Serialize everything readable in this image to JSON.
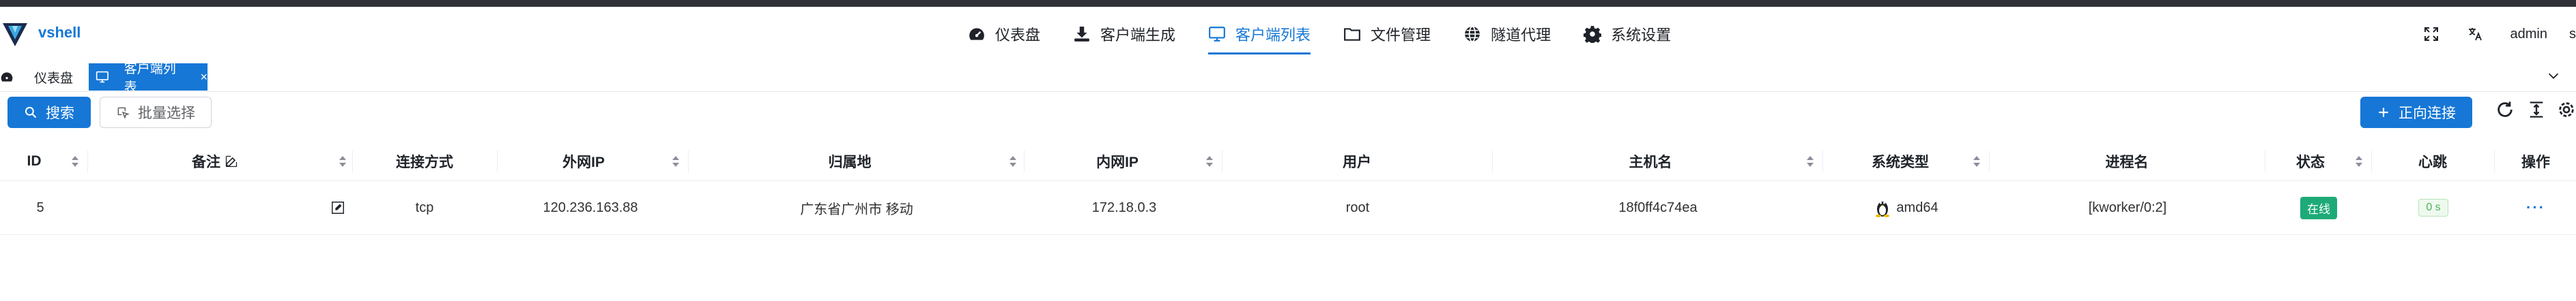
{
  "app": {
    "name": "vshell"
  },
  "nav": {
    "items": [
      {
        "label": "仪表盘",
        "icon": "dashboard-icon"
      },
      {
        "label": "客户端生成",
        "icon": "download-icon"
      },
      {
        "label": "客户端列表",
        "icon": "monitor-icon",
        "active": true
      },
      {
        "label": "文件管理",
        "icon": "folder-icon"
      },
      {
        "label": "隧道代理",
        "icon": "globe-icon"
      },
      {
        "label": "系统设置",
        "icon": "gear-icon"
      }
    ]
  },
  "header": {
    "user": "admin",
    "edge_char": "s"
  },
  "tabs": [
    {
      "label": "仪表盘",
      "icon": "dashboard-icon"
    },
    {
      "label": "客户端列表",
      "icon": "monitor-icon",
      "close": "×",
      "active": true
    }
  ],
  "toolbar": {
    "search_label": "搜索",
    "batch_label": "批量选择",
    "connect_label": "正向连接"
  },
  "table": {
    "columns": [
      "ID",
      "备注",
      "连接方式",
      "外网IP",
      "归属地",
      "内网IP",
      "用户",
      "主机名",
      "系统类型",
      "进程名",
      "状态",
      "心跳",
      "操作"
    ],
    "rows": [
      {
        "id": "5",
        "note": "",
        "conn": "tcp",
        "public_ip": "120.236.163.88",
        "location": "广东省广州市 移动",
        "private_ip": "172.18.0.3",
        "user": "root",
        "hostname": "18f0ff4c74ea",
        "os": "amd64",
        "process": "[kworker/0:2]",
        "status": "在线",
        "heartbeat": "0 s",
        "action": "···"
      }
    ]
  },
  "colors": {
    "accent": "#1677d6",
    "online": "#1eaa78",
    "heartbeat_bg": "#eef9ee"
  }
}
